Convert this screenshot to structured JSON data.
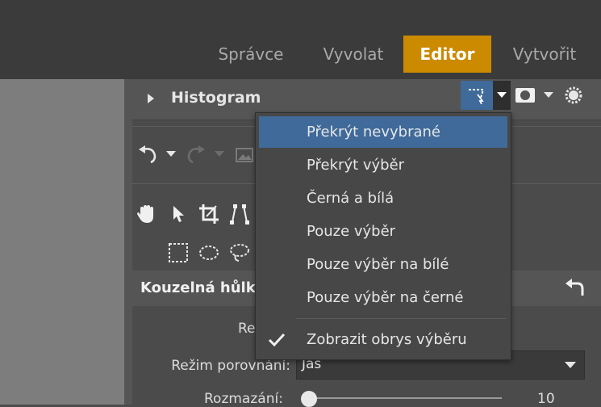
{
  "top_tabs": [
    {
      "label": "Správce"
    },
    {
      "label": "Vyvolat"
    },
    {
      "label": "Editor"
    },
    {
      "label": "Vytvořit"
    }
  ],
  "histogram": {
    "title": "Histogram"
  },
  "kouzelna": {
    "title": "Kouzelná hůlk",
    "row1_label": "Re"
  },
  "compare": {
    "label": "Režim porovnání:",
    "value": "Jas"
  },
  "blur": {
    "label": "Rozmazání:",
    "value": "10"
  },
  "menu": {
    "items": [
      {
        "label": "Překrýt nevybrané"
      },
      {
        "label": "Překrýt výběr"
      },
      {
        "label": "Černá a bílá"
      },
      {
        "label": "Pouze výběr"
      },
      {
        "label": "Pouze výběr na bílé"
      },
      {
        "label": "Pouze výběr na černé"
      }
    ],
    "toggle": {
      "label": "Zobrazit obrys výběru",
      "checked": true
    }
  },
  "colors": {
    "accent": "#cb8a00",
    "highlight": "#3f6a9a"
  }
}
